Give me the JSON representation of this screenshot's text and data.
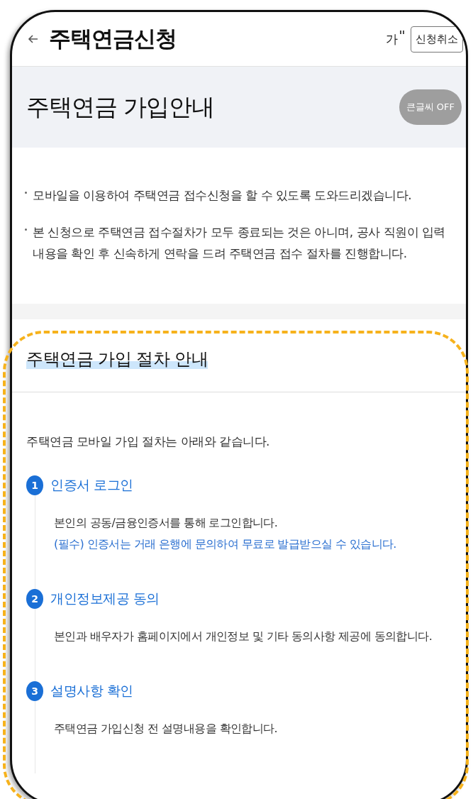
{
  "header": {
    "title": "주택연금신청",
    "font_size_label": "가",
    "cancel_button": "신청취소"
  },
  "hero": {
    "title": "주택연금 가입안내",
    "large_text_toggle": {
      "label": "큰글씨 OFF",
      "on": false
    }
  },
  "notices": [
    "모바일을 이용하여 주택연금 접수신청을 할 수 있도록 도와드리겠습니다.",
    "본 신청으로 주택연금 접수절차가 모두 종료되는 것은 아니며, 공사 직원이 입력내용을 확인 후 신속하게 연락을 드려 주택연금 접수 절차를 진행합니다."
  ],
  "procedure": {
    "title": "주택연금 가입 절차 안내",
    "intro": "주택연금 모바일 가입 절차는 아래와 같습니다.",
    "steps": [
      {
        "number": "1",
        "title": "인증서 로그인",
        "lines": [
          {
            "kind": "normal",
            "text": "본인의 공동/금융인증서를 통해 로그인합니다."
          },
          {
            "kind": "note",
            "text": "(필수) 인증서는 거래 은행에 문의하여 무료로 발급받으실 수 있습니다."
          }
        ]
      },
      {
        "number": "2",
        "title": "개인정보제공 동의",
        "lines": [
          {
            "kind": "normal",
            "text": "본인과 배우자가 홈페이지에서 개인정보 및 기타 동의사항 제공에 동의합니다."
          }
        ]
      },
      {
        "number": "3",
        "title": "설명사항 확인",
        "lines": [
          {
            "kind": "normal",
            "text": "주택연금 가입신청 전 설명내용을 확인합니다."
          }
        ]
      }
    ]
  }
}
